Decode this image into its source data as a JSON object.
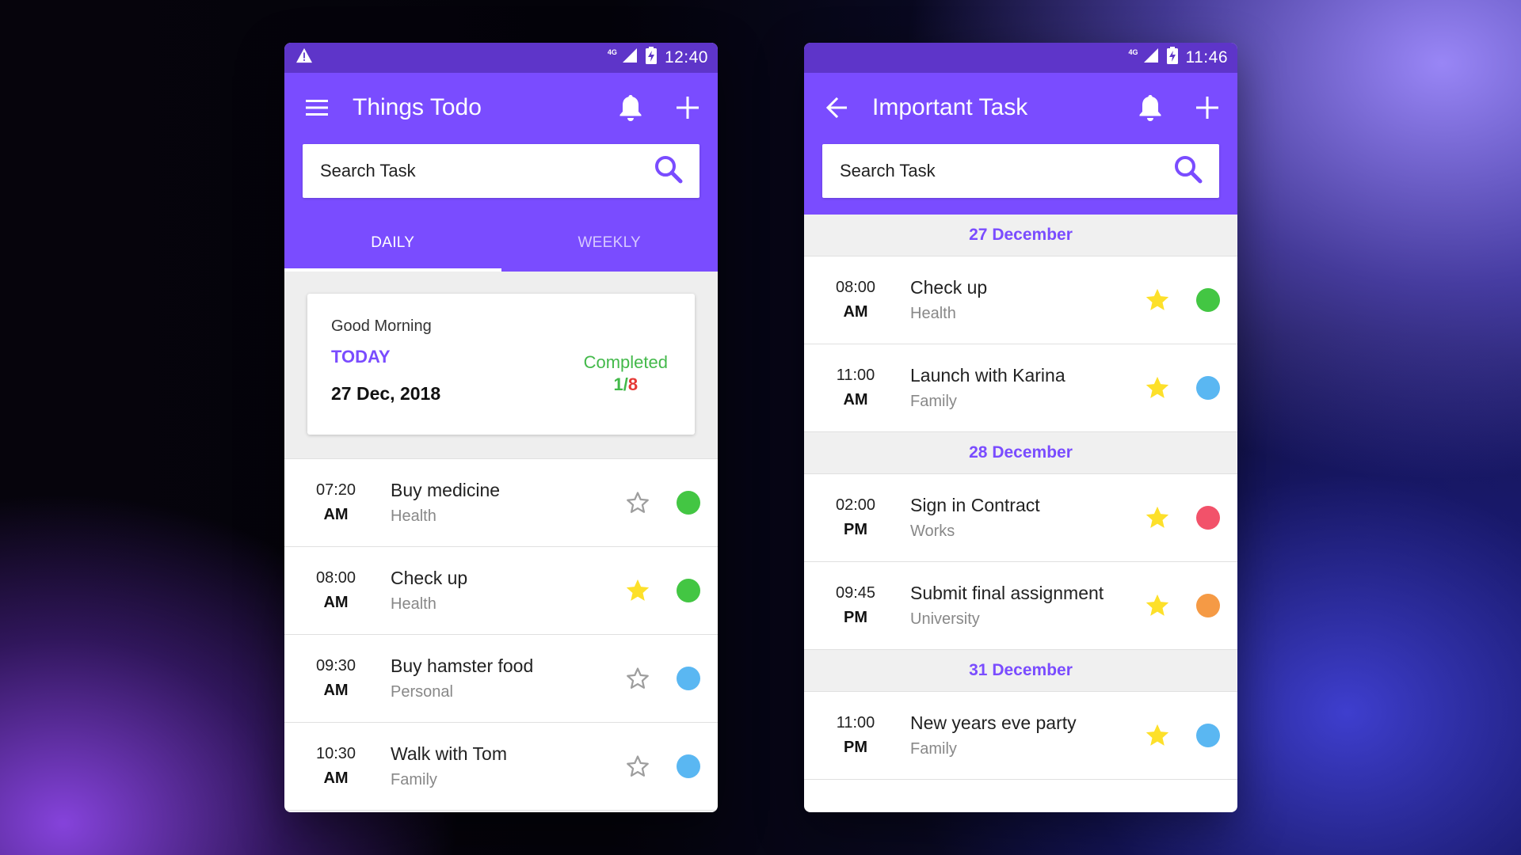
{
  "colors": {
    "primary": "#7a4cff",
    "status_bar": "#5e35c9",
    "star_active": "#fde02a",
    "star_inactive": "#9e9e9e",
    "health": "#43c643",
    "family": "#5ab7f2",
    "personal": "#5ab7f2",
    "works": "#f2526a",
    "university": "#f59a45"
  },
  "left_screen": {
    "status_time": "12:40",
    "net_label": "4G",
    "title": "Things Todo",
    "search_placeholder": "Search Task",
    "tabs": [
      {
        "label": "DAILY",
        "active": true
      },
      {
        "label": "WEEKLY",
        "active": false
      }
    ],
    "summary": {
      "greeting": "Good Morning",
      "today_label": "TODAY",
      "date": "27 Dec, 2018",
      "completed_label": "Completed",
      "completed_done": "1",
      "completed_sep": "/",
      "completed_total": "8"
    },
    "tasks": [
      {
        "time": "07:20",
        "ampm": "AM",
        "name": "Buy medicine",
        "category": "Health",
        "starred": false,
        "dot": "#43c643"
      },
      {
        "time": "08:00",
        "ampm": "AM",
        "name": "Check up",
        "category": "Health",
        "starred": true,
        "dot": "#43c643"
      },
      {
        "time": "09:30",
        "ampm": "AM",
        "name": "Buy hamster food",
        "category": "Personal",
        "starred": false,
        "dot": "#5ab7f2"
      },
      {
        "time": "10:30",
        "ampm": "AM",
        "name": "Walk with Tom",
        "category": "Family",
        "starred": false,
        "dot": "#5ab7f2"
      }
    ]
  },
  "right_screen": {
    "status_time": "11:46",
    "net_label": "4G",
    "title": "Important Task",
    "search_placeholder": "Search Task",
    "groups": [
      {
        "date": "27 December",
        "tasks": [
          {
            "time": "08:00",
            "ampm": "AM",
            "name": "Check up",
            "category": "Health",
            "starred": true,
            "dot": "#43c643"
          },
          {
            "time": "11:00",
            "ampm": "AM",
            "name": "Launch with Karina",
            "category": "Family",
            "starred": true,
            "dot": "#5ab7f2"
          }
        ]
      },
      {
        "date": "28 December",
        "tasks": [
          {
            "time": "02:00",
            "ampm": "PM",
            "name": "Sign in Contract",
            "category": "Works",
            "starred": true,
            "dot": "#f2526a"
          },
          {
            "time": "09:45",
            "ampm": "PM",
            "name": "Submit final assignment",
            "category": "University",
            "starred": true,
            "dot": "#f59a45"
          }
        ]
      },
      {
        "date": "31 December",
        "tasks": [
          {
            "time": "11:00",
            "ampm": "PM",
            "name": "New years eve party",
            "category": "Family",
            "starred": true,
            "dot": "#5ab7f2"
          }
        ]
      }
    ]
  }
}
